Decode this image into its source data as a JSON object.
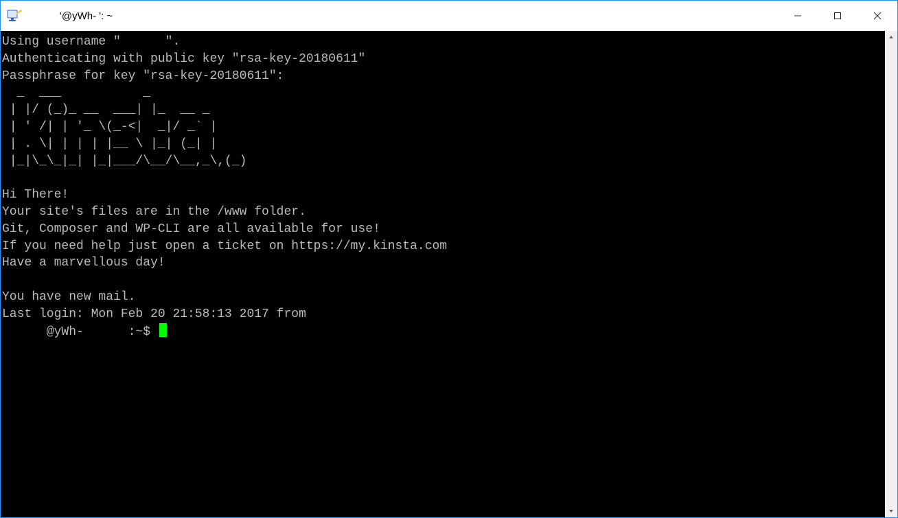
{
  "window": {
    "title": "      '@yWh-       ': ~"
  },
  "terminal": {
    "lines": [
      "Using username \"      \".",
      "Authenticating with public key \"rsa-key-20180611\"",
      "Passphrase for key \"rsa-key-20180611\":",
      "  _  ___           _",
      " | |/ (_)_ __  ___| |_  __ _",
      " | ' /| | '_ \\(_-<|  _|/ _` |",
      " | . \\| | | | |__ \\ |_| (_| |",
      " |_|\\_\\_|_| |_|___/\\__/\\__,_\\,(_)",
      "",
      "Hi There!",
      "Your site's files are in the /www folder.",
      "Git, Composer and WP-CLI are all available for use!",
      "If you need help just open a ticket on https://my.kinsta.com",
      "Have a marvellous day!",
      "",
      "You have new mail.",
      "Last login: Mon Feb 20 21:58:13 2017 from"
    ],
    "prompt": "      @yWh-      :~$ "
  }
}
